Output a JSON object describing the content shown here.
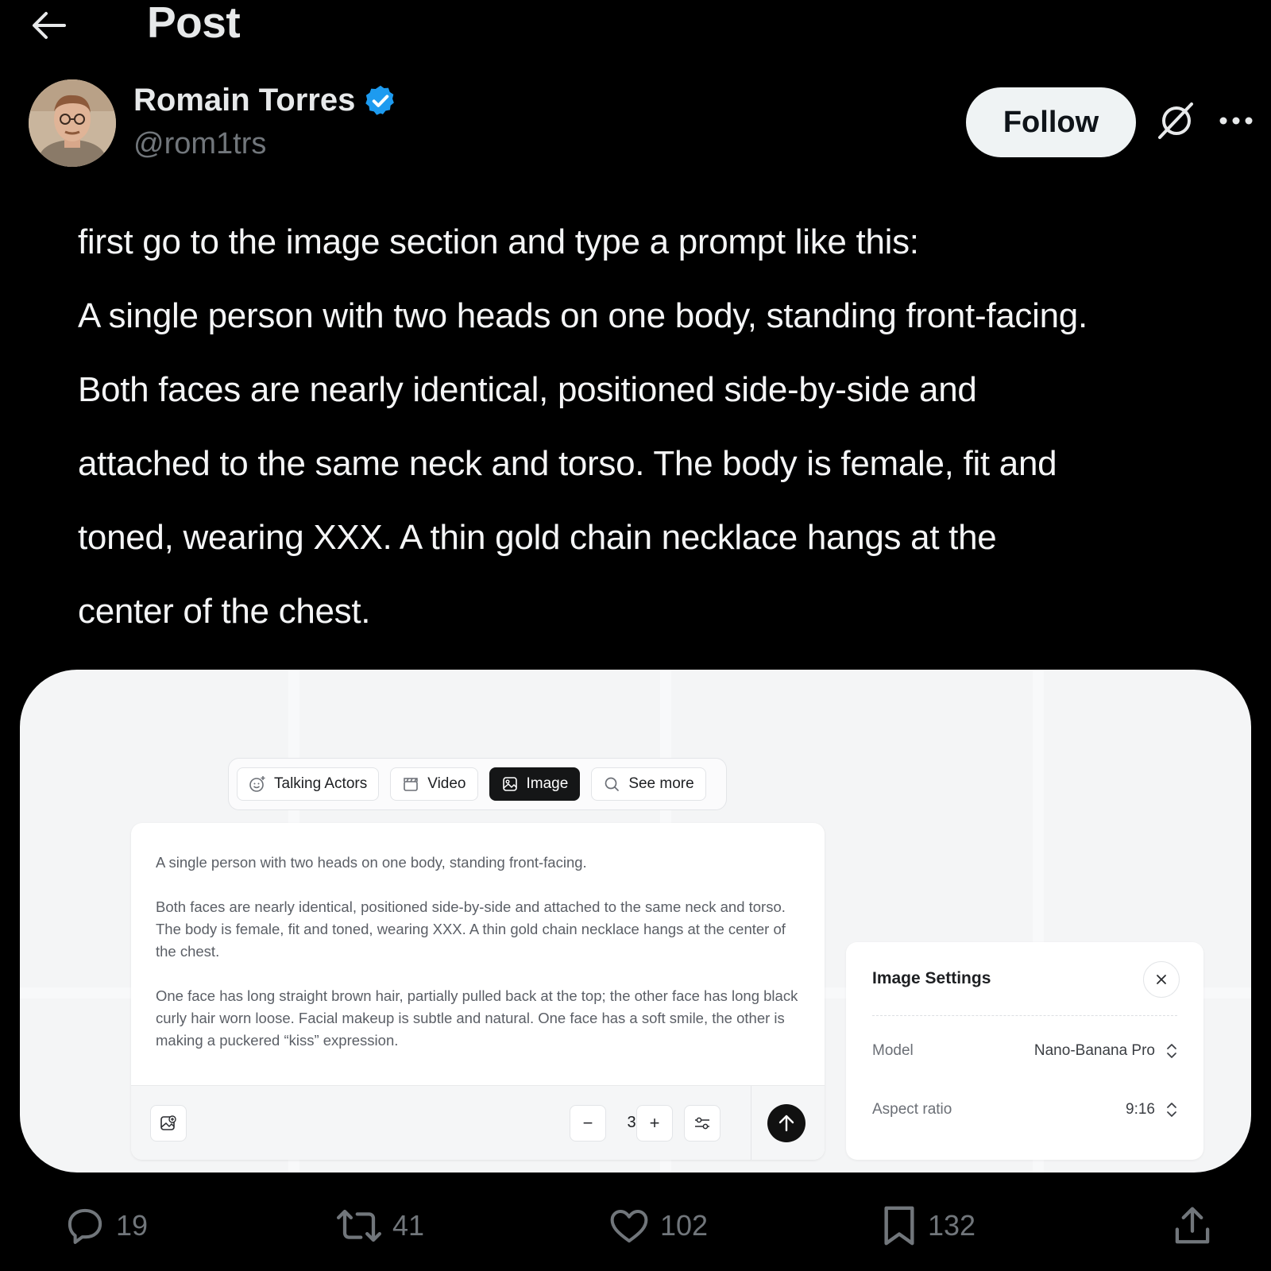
{
  "header": {
    "title": "Post",
    "back_icon": "arrow-left-icon"
  },
  "author": {
    "display_name": "Romain Torres",
    "handle": "@rom1trs",
    "verified": true,
    "verified_color": "#1d9bf0",
    "follow_label": "Follow",
    "grok_icon": "grok-icon",
    "more_icon": "more-horizontal-icon"
  },
  "post": {
    "lines": [
      "first go to the image section and type a prompt like this:",
      "A single person with two heads on one body, standing front-facing.",
      "Both faces are nearly identical, positioned side-by-side and",
      "attached to the same neck and torso. The body is female, fit and",
      "toned, wearing XXX. A thin gold chain necklace hangs at the",
      "center of the chest."
    ]
  },
  "media": {
    "tabs": [
      {
        "label": "Talking Actors",
        "icon": "smile-sparkle-icon",
        "active": false
      },
      {
        "label": "Video",
        "icon": "clapperboard-icon",
        "active": false
      },
      {
        "label": "Image",
        "icon": "image-icon",
        "active": true
      },
      {
        "label": "See more",
        "icon": "search-icon",
        "active": false
      }
    ],
    "prompt": {
      "paragraphs": [
        "A single person with two heads on one body, standing front-facing.",
        "Both faces are nearly identical, positioned side-by-side and attached to the same neck and torso. The body is female, fit and toned, wearing XXX. A thin gold chain necklace hangs at the center of the chest.",
        "One face has long straight brown hair, partially pulled back at the top; the other face has long black curly hair worn loose. Facial makeup is subtle and natural. One face has a soft smile, the other is making a puckered “kiss” expression."
      ],
      "quantity": "3",
      "minus_label": "−",
      "plus_label": "+"
    },
    "settings": {
      "title": "Image Settings",
      "model_label": "Model",
      "model_value": "Nano-Banana Pro",
      "aspect_label": "Aspect ratio",
      "aspect_value": "9:16"
    }
  },
  "actions": {
    "replies": "19",
    "reposts": "41",
    "likes": "102",
    "bookmarks": "132"
  }
}
